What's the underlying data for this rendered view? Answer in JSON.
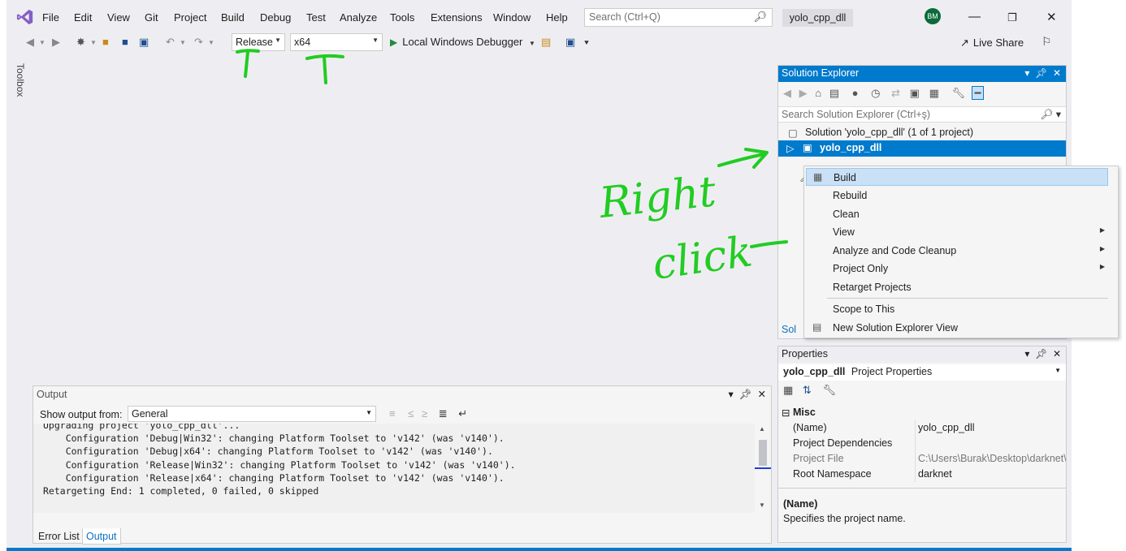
{
  "menubar": {
    "items": [
      "File",
      "Edit",
      "View",
      "Git",
      "Project",
      "Build",
      "Debug",
      "Test",
      "Analyze",
      "Tools",
      "Extensions",
      "Window",
      "Help"
    ],
    "search_placeholder": "Search (Ctrl+Q)",
    "project_name": "yolo_cpp_dll",
    "avatar_initials": "BM"
  },
  "toolbar": {
    "configuration": "Release",
    "platform": "x64",
    "debugger": "Local Windows Debugger",
    "live_share": "Live Share"
  },
  "toolbox": {
    "label": "Toolbox"
  },
  "solution_explorer": {
    "title": "Solution Explorer",
    "search_placeholder": "Search Solution Explorer (Ctrl+ş)",
    "solution_label": "Solution 'yolo_cpp_dll' (1 of 1 project)",
    "project_label": "yolo_cpp_dll",
    "bottom_tab": "Sol"
  },
  "context_menu": {
    "items": [
      {
        "label": "Build",
        "submenu": false,
        "icon": "build-icon"
      },
      {
        "label": "Rebuild",
        "submenu": false
      },
      {
        "label": "Clean",
        "submenu": false
      },
      {
        "label": "View",
        "submenu": true
      },
      {
        "label": "Analyze and Code Cleanup",
        "submenu": true
      },
      {
        "label": "Project Only",
        "submenu": true
      },
      {
        "label": "Retarget Projects",
        "submenu": false
      },
      {
        "label": "Scope to This",
        "submenu": false
      },
      {
        "label": "New Solution Explorer View",
        "submenu": false,
        "icon": "new-view-icon"
      }
    ]
  },
  "properties": {
    "title": "Properties",
    "object_name": "yolo_cpp_dll",
    "object_type": "Project Properties",
    "category": "Misc",
    "rows": [
      {
        "key": "(Name)",
        "value": "yolo_cpp_dll"
      },
      {
        "key": "Project Dependencies",
        "value": ""
      },
      {
        "key": "Project File",
        "value": "C:\\Users\\Burak\\Desktop\\darknet\\"
      },
      {
        "key": "Root Namespace",
        "value": "darknet"
      }
    ],
    "desc_title": "(Name)",
    "desc_text": "Specifies the project name."
  },
  "output": {
    "title": "Output",
    "show_from_label": "Show output from:",
    "source": "General",
    "lines": [
      "Upgrading project 'yolo_cpp_dll'...",
      "    Configuration 'Debug|Win32': changing Platform Toolset to 'v142' (was 'v140').",
      "    Configuration 'Debug|x64': changing Platform Toolset to 'v142' (was 'v140').",
      "    Configuration 'Release|Win32': changing Platform Toolset to 'v142' (was 'v140').",
      "    Configuration 'Release|x64': changing Platform Toolset to 'v142' (was 'v140').",
      "Retargeting End: 1 completed, 0 failed, 0 skipped"
    ],
    "tabs": [
      "Error List",
      "Output"
    ]
  },
  "annotation": {
    "color": "#22cc22",
    "words": [
      "Right",
      "click"
    ]
  },
  "colors": {
    "accent": "#007acc",
    "selection": "#007acc",
    "menu_highlight": "#c9e0f7"
  }
}
